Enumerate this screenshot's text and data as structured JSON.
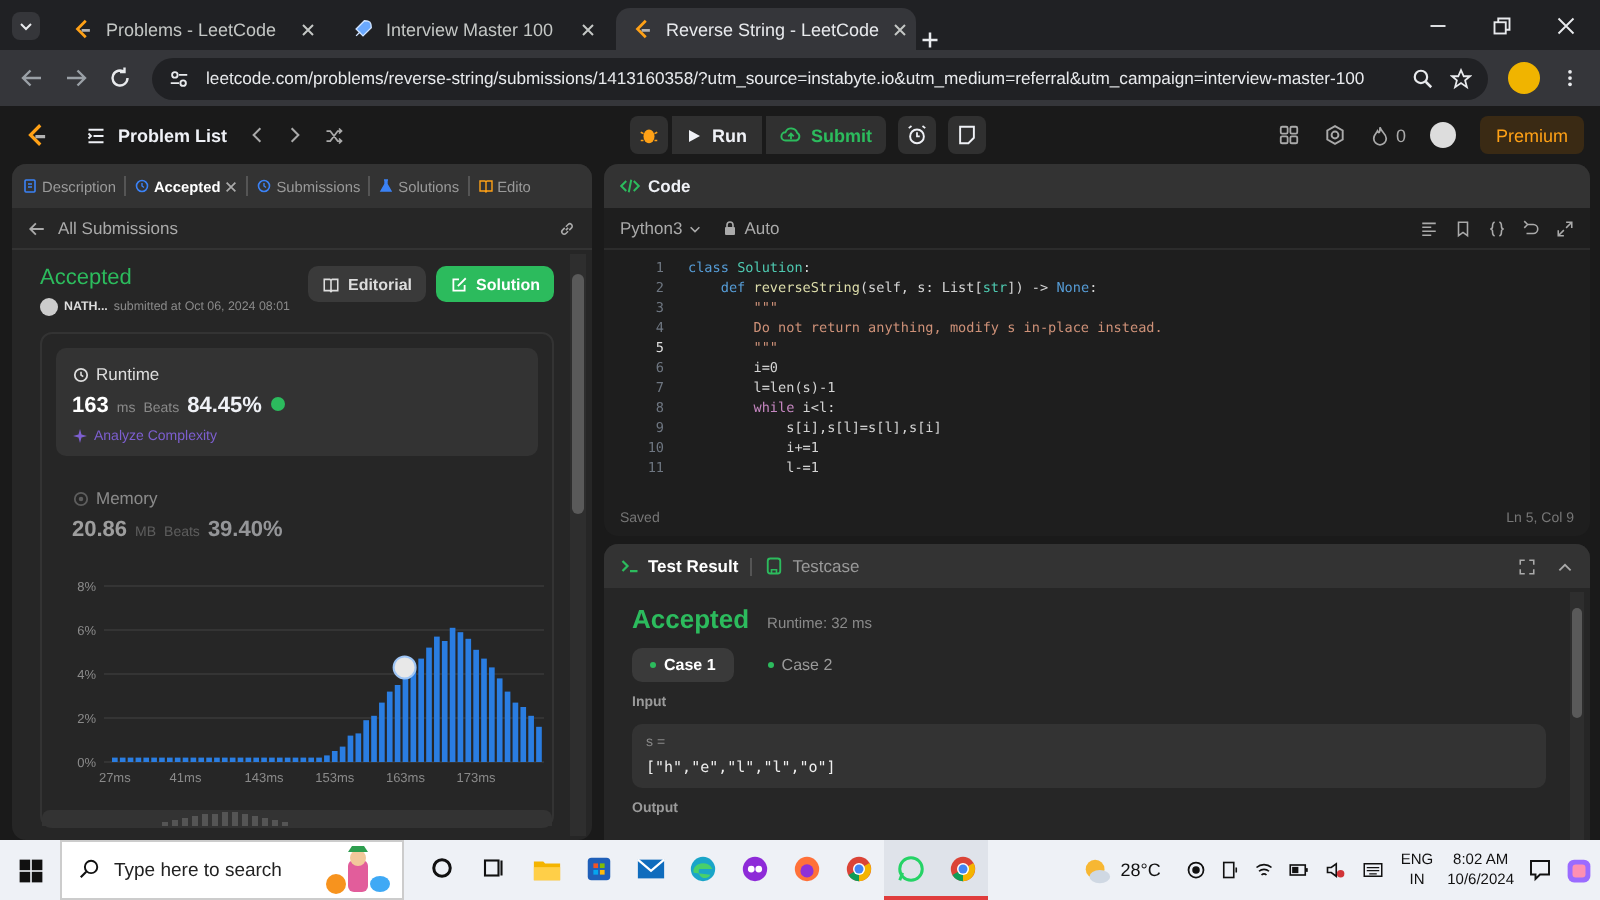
{
  "browser": {
    "tabs": [
      {
        "title": "Problems - LeetCode",
        "kind": "leetcode",
        "selected": false
      },
      {
        "title": "Interview Master 100",
        "kind": "rocket",
        "selected": false
      },
      {
        "title": "Reverse String - LeetCode",
        "kind": "leetcode",
        "selected": true
      }
    ],
    "url": "leetcode.com/problems/reverse-string/submissions/1413160358/?utm_source=instabyte.io&utm_medium=referral&utm_campaign=interview-master-100"
  },
  "toolbar": {
    "problem_list": "Problem List",
    "run": "Run",
    "submit": "Submit",
    "streak": "0",
    "premium": "Premium"
  },
  "left_panel": {
    "tabs": [
      {
        "label": "Description",
        "kind": "doc",
        "selected": false,
        "closable": false
      },
      {
        "label": "Accepted",
        "kind": "clock",
        "selected": true,
        "closable": true
      },
      {
        "label": "Submissions",
        "kind": "clock",
        "selected": false,
        "closable": false
      },
      {
        "label": "Solutions",
        "kind": "flask",
        "selected": false,
        "closable": false
      },
      {
        "label": "Edito",
        "kind": "book",
        "selected": false,
        "closable": false
      }
    ],
    "back": "All Submissions",
    "status": "Accepted",
    "user": "NATH...",
    "submitted": "submitted at Oct 06, 2024 08:01",
    "editorial": "Editorial",
    "solution": "Solution",
    "metrics": [
      {
        "kind": "clock",
        "label": "Runtime",
        "value": "163",
        "unit": "ms",
        "beats_label": "Beats",
        "beats": "84.45%",
        "selected": true
      },
      {
        "kind": "chip",
        "label": "Memory",
        "value": "20.86",
        "unit": "MB",
        "beats_label": "Beats",
        "beats": "39.40%",
        "selected": false
      }
    ],
    "analyze": "Analyze Complexity",
    "chart_data": {
      "type": "bar",
      "orientation": "vertical",
      "grid": true,
      "ylim": [
        0,
        8
      ],
      "yticks": [
        {
          "value": 0,
          "label": "0%"
        },
        {
          "value": 2,
          "label": "2%"
        },
        {
          "value": 4,
          "label": "4%"
        },
        {
          "value": 6,
          "label": "6%"
        },
        {
          "value": 8,
          "label": "8%"
        }
      ],
      "categories": [
        "27ms",
        null,
        null,
        null,
        null,
        null,
        null,
        null,
        null,
        "41ms",
        null,
        null,
        null,
        null,
        null,
        null,
        null,
        null,
        null,
        "143ms",
        null,
        null,
        null,
        null,
        null,
        null,
        null,
        null,
        "153ms",
        null,
        null,
        null,
        null,
        null,
        null,
        null,
        null,
        "163ms",
        null,
        null,
        null,
        null,
        null,
        null,
        null,
        null,
        "173ms",
        null,
        null,
        null,
        null,
        null,
        null,
        null,
        null
      ],
      "values": [
        0.2,
        0.2,
        0.2,
        0.2,
        0.2,
        0.2,
        0.2,
        0.2,
        0.2,
        0.2,
        0.2,
        0.2,
        0.2,
        0.2,
        0.2,
        0.2,
        0.2,
        0.2,
        0.2,
        0.2,
        0.2,
        0.2,
        0.2,
        0.2,
        0.2,
        0.2,
        0.2,
        0.3,
        0.5,
        0.7,
        1.2,
        1.3,
        1.9,
        2.1,
        2.7,
        3.2,
        3.5,
        3.9,
        4.2,
        4.7,
        5.2,
        5.7,
        5.5,
        6.1,
        5.9,
        5.6,
        5.1,
        4.7,
        4.3,
        3.8,
        3.2,
        2.7,
        2.5,
        2.1,
        1.6
      ]
    }
  },
  "code": {
    "title": "Code",
    "language": "Python3",
    "mode": "Auto",
    "lines": [
      {
        "number": "1",
        "current": false,
        "tokens": [
          {
            "kind": "keyword",
            "text": "class "
          },
          {
            "kind": "type",
            "text": "Solution"
          },
          {
            "kind": "plain",
            "text": ":"
          }
        ]
      },
      {
        "number": "2",
        "current": false,
        "tokens": [
          {
            "kind": "keyword",
            "text": "    def "
          },
          {
            "kind": "function",
            "text": "reverseString"
          },
          {
            "kind": "plain",
            "text": "(self, s: List["
          },
          {
            "kind": "type",
            "text": "str"
          },
          {
            "kind": "plain",
            "text": "]) -> "
          },
          {
            "kind": "keyword",
            "text": "None"
          },
          {
            "kind": "plain",
            "text": ":"
          }
        ]
      },
      {
        "number": "3",
        "current": false,
        "tokens": [
          {
            "kind": "string",
            "text": "        \"\"\""
          }
        ]
      },
      {
        "number": "4",
        "current": false,
        "tokens": [
          {
            "kind": "string",
            "text": "        Do not return anything, modify s in-place instead."
          }
        ]
      },
      {
        "number": "5",
        "current": true,
        "tokens": [
          {
            "kind": "string",
            "text": "        \"\"\""
          }
        ]
      },
      {
        "number": "6",
        "current": false,
        "tokens": [
          {
            "kind": "plain",
            "text": "        i=0"
          }
        ]
      },
      {
        "number": "7",
        "current": false,
        "tokens": [
          {
            "kind": "plain",
            "text": "        l=len(s)-1"
          }
        ]
      },
      {
        "number": "8",
        "current": false,
        "tokens": [
          {
            "kind": "control",
            "text": "        while"
          },
          {
            "kind": "plain",
            "text": " i<l:"
          }
        ]
      },
      {
        "number": "9",
        "current": false,
        "tokens": [
          {
            "kind": "plain",
            "text": "            s[i],s[l]=s[l],s[i]"
          }
        ]
      },
      {
        "number": "10",
        "current": false,
        "tokens": [
          {
            "kind": "plain",
            "text": "            i+=1"
          }
        ]
      },
      {
        "number": "11",
        "current": false,
        "tokens": [
          {
            "kind": "plain",
            "text": "            l-=1"
          }
        ]
      }
    ],
    "saved": "Saved",
    "cursor": "Ln 5, Col 9"
  },
  "test_result": {
    "tabs": [
      {
        "label": "Test Result",
        "kind": "terminal",
        "selected": true
      },
      {
        "label": "Testcase",
        "kind": "box",
        "selected": false
      }
    ],
    "status": "Accepted",
    "runtime": "Runtime: 32 ms",
    "cases": [
      {
        "label": "Case 1",
        "selected": true
      },
      {
        "label": "Case 2",
        "selected": false
      }
    ],
    "input_label": "Input",
    "param": "s =",
    "value": "[\"h\",\"e\",\"l\",\"l\",\"o\"]",
    "output_label": "Output"
  },
  "taskbar": {
    "search_placeholder": "Type here to search",
    "apps": [
      {
        "kind": "explorer",
        "running": false
      },
      {
        "kind": "store",
        "running": false
      },
      {
        "kind": "mail",
        "running": false
      },
      {
        "kind": "edge",
        "running": false
      },
      {
        "kind": "app",
        "running": false
      },
      {
        "kind": "firefox",
        "running": false
      },
      {
        "kind": "chrome",
        "running": false
      },
      {
        "kind": "whatsapp",
        "running": true
      },
      {
        "kind": "chrome",
        "running": true
      }
    ],
    "weather": "28°C",
    "lang": "ENG",
    "region": "IN",
    "time": "8:02 AM",
    "date": "10/6/2024"
  }
}
